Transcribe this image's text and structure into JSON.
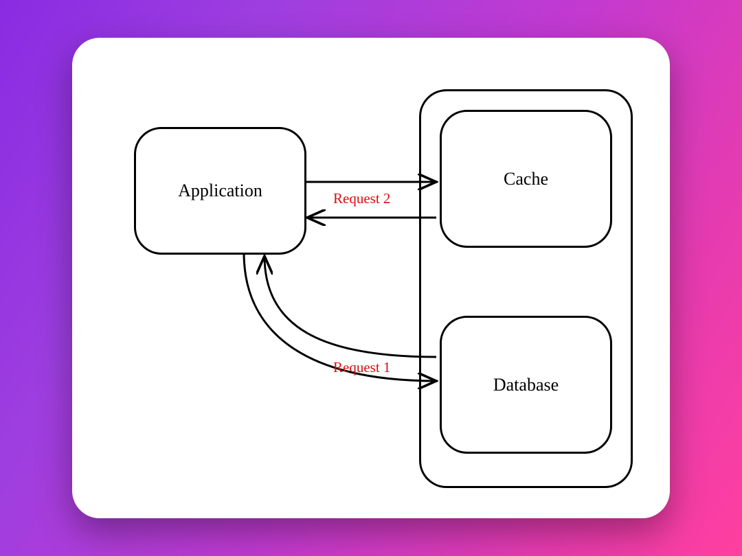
{
  "diagram": {
    "nodes": {
      "application": {
        "label": "Application"
      },
      "cache": {
        "label": "Cache"
      },
      "database": {
        "label": "Database"
      }
    },
    "edges": {
      "request1": {
        "label": "Request 1",
        "from": "application",
        "to": "database",
        "bidirectional": true
      },
      "request2": {
        "label": "Request 2",
        "from": "application",
        "to": "cache",
        "bidirectional": true
      }
    },
    "colors": {
      "label_accent": "#d90d0d",
      "stroke": "#000000"
    }
  }
}
